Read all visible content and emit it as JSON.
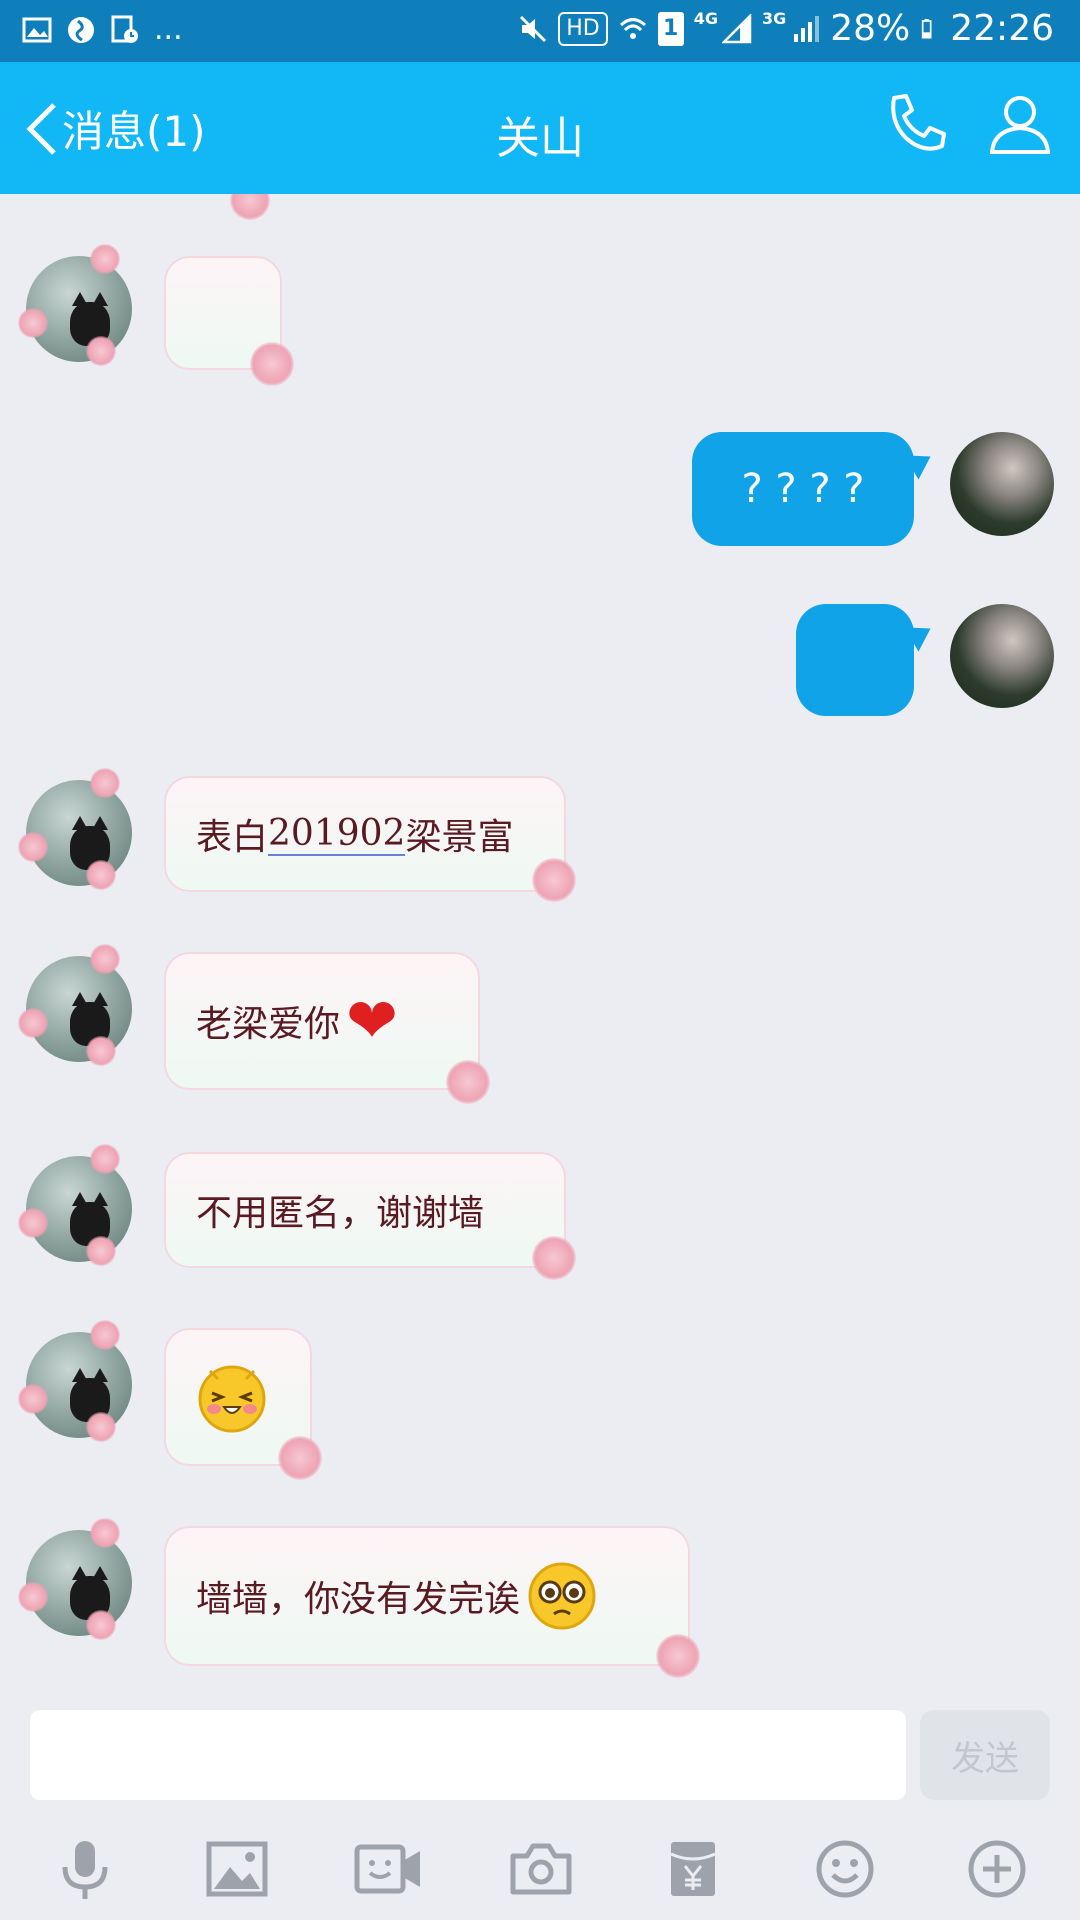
{
  "status_bar": {
    "hd": "HD",
    "sim": "1",
    "net1": "4G",
    "net2": "3G",
    "battery": "28%",
    "time": "22:26",
    "more": "..."
  },
  "header": {
    "back_label": "消息(1)",
    "title": "关山"
  },
  "messages": [
    {
      "side": "in",
      "text": ""
    },
    {
      "side": "out",
      "text": "? ? ? ?"
    },
    {
      "side": "out",
      "text": ""
    },
    {
      "side": "in",
      "text_a": "表白",
      "text_b": "201902",
      "text_c": "梁景富"
    },
    {
      "side": "in",
      "text": "老梁爱你"
    },
    {
      "side": "in",
      "text": "不用匿名，谢谢墙"
    },
    {
      "side": "in",
      "text": ""
    },
    {
      "side": "in",
      "text": "墙墙，你没有发完诶"
    }
  ],
  "input": {
    "placeholder": "",
    "send_label": "发送"
  },
  "toolbar": {
    "icons": [
      "microphone-icon",
      "image-icon",
      "video-icon",
      "camera-icon",
      "red-packet-icon",
      "emoji-icon",
      "plus-icon"
    ]
  },
  "colors": {
    "status_bar": "#0f7fbc",
    "title_bar": "#12b7f5",
    "outgoing_bubble": "#10a3e8",
    "background": "#ebedf2"
  }
}
